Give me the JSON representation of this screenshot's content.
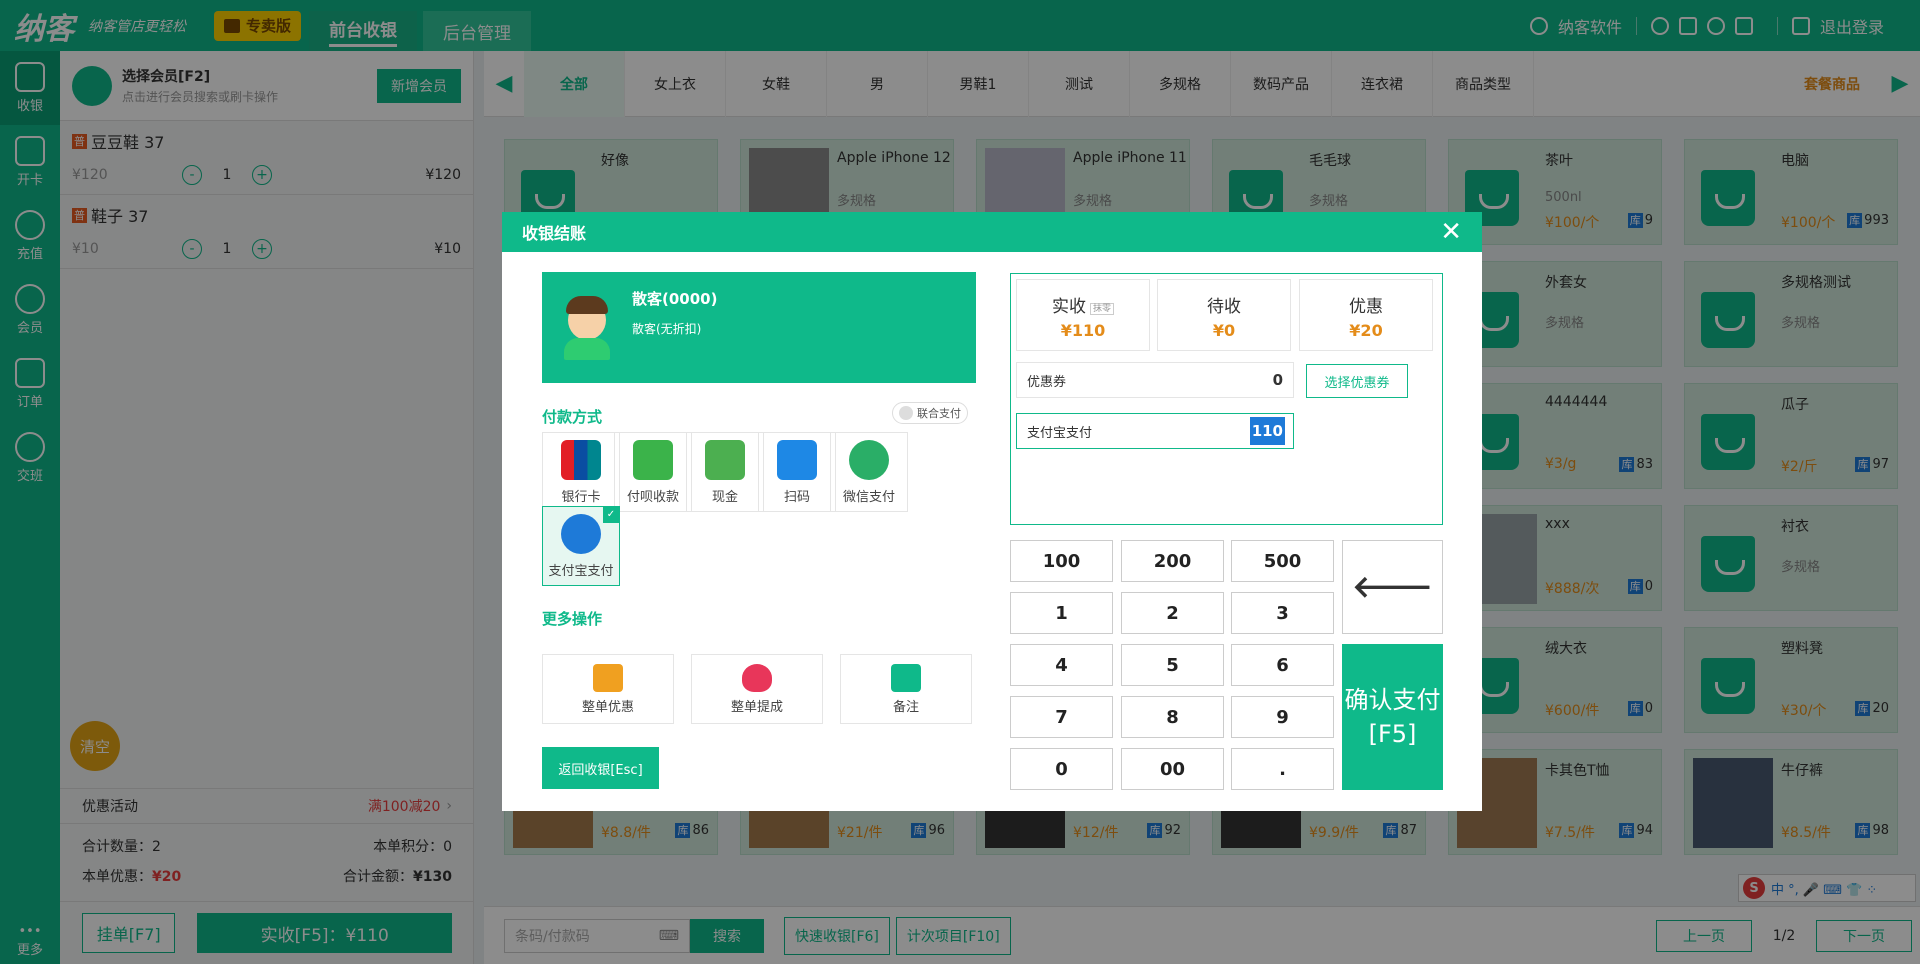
{
  "top": {
    "logo": "纳客",
    "slogan": "纳客管店更轻松",
    "edition": "专卖版",
    "tabs": [
      "前台收银",
      "后台管理"
    ],
    "company": "纳客软件",
    "logout": "退出登录"
  },
  "side": {
    "items": [
      "收银",
      "开卡",
      "充值",
      "会员",
      "订单",
      "交班"
    ],
    "more": "更多"
  },
  "cart": {
    "member_title": "选择会员[F2]",
    "member_hint": "点击进行会员搜索或刷卡操作",
    "add_member": "新增会员",
    "tag": "普",
    "items": [
      {
        "name": "豆豆鞋 37",
        "price": "¥120",
        "qty": "1",
        "sum": "¥120"
      },
      {
        "name": "鞋子 37",
        "price": "¥10",
        "qty": "1",
        "sum": "¥10"
      }
    ],
    "minus": "-",
    "plus": "+",
    "clear": "清空",
    "promo_label": "优惠活动",
    "promo_value": "满100减20",
    "total_qty_label": "合计数量：2",
    "points_label": "本单积分：0",
    "discount_label": "本单优惠：",
    "discount_value": "¥20",
    "total_label": "合计金额：",
    "total_value": "¥130",
    "hang": "挂单[F7]",
    "pay": "实收[F5]：¥110"
  },
  "cats": {
    "items": [
      "全部",
      "女上衣",
      "女鞋",
      "男",
      "男鞋1",
      "测试",
      "多规格",
      "数码产品",
      "连衣裙",
      "商品类型"
    ],
    "special": "套餐商品"
  },
  "products": [
    {
      "name": "好像",
      "spec": "",
      "price": "",
      "stock": ""
    },
    {
      "name": "Apple iPhone 12",
      "spec": "多规格",
      "price": "",
      "stock": ""
    },
    {
      "name": "Apple iPhone 11",
      "spec": "多规格",
      "price": "",
      "stock": ""
    },
    {
      "name": "毛毛球",
      "spec": "多规格",
      "price": "",
      "stock": ""
    },
    {
      "name": "茶叶",
      "spec": "500nl",
      "price": "¥100/个",
      "stock": "9"
    },
    {
      "name": "电脑",
      "spec": "",
      "price": "¥100/个",
      "stock": "993"
    },
    {
      "name": "外套女",
      "spec": "多规格",
      "price": "",
      "stock": ""
    },
    {
      "name": "多规格测试",
      "spec": "多规格",
      "price": "",
      "stock": ""
    },
    {
      "name": "4444444",
      "spec": "",
      "price": "¥3/g",
      "stock": "83"
    },
    {
      "name": "瓜子",
      "spec": "",
      "price": "¥2/斤",
      "stock": "97"
    },
    {
      "name": "xxx",
      "spec": "",
      "price": "¥888/次",
      "stock": "0"
    },
    {
      "name": "衬衣",
      "spec": "多规格",
      "price": "",
      "stock": ""
    },
    {
      "name": "绒大衣",
      "spec": "",
      "price": "¥600/件",
      "stock": "0"
    },
    {
      "name": "塑料凳",
      "spec": "",
      "price": "¥30/个",
      "stock": "20"
    },
    {
      "name": "卡其色T恤",
      "spec": "",
      "price": "¥7.5/件",
      "stock": "94"
    },
    {
      "name": "牛仔裤",
      "spec": "",
      "price": "¥8.5/件",
      "stock": "98"
    },
    {
      "name": "",
      "spec": "",
      "price": "¥8.8/件",
      "stock": "86"
    },
    {
      "name": "",
      "spec": "",
      "price": "¥21/件",
      "stock": "96"
    },
    {
      "name": "",
      "spec": "",
      "price": "¥12/件",
      "stock": "92"
    },
    {
      "name": "",
      "spec": "",
      "price": "¥9.9/件",
      "stock": "87"
    }
  ],
  "stock_tag": "库",
  "bottom": {
    "barcode_placeholder": "条码/付款码",
    "search": "搜索",
    "quick": "快速收银[F6]",
    "timed": "计次项目[F10]",
    "prev": "上一页",
    "page": "1/2",
    "next": "下一页"
  },
  "ime": {
    "logo": "S",
    "text": "中 °, 🎤 ⌨ 👕 ⁘"
  },
  "modal": {
    "title": "收银结账",
    "close": "✕",
    "customer_name": "散客(0000)",
    "customer_discount": "散客(无折扣)",
    "pay_methods_title": "付款方式",
    "combine": "联合支付",
    "pay_methods": [
      "银行卡",
      "付呗收款",
      "现金",
      "扫码",
      "微信支付",
      "支付宝支付"
    ],
    "more_ops_title": "更多操作",
    "ops": [
      "整单优惠",
      "整单提成",
      "备注"
    ],
    "return": "返回收银[Esc]",
    "received_label": "实收",
    "received_mini": "抹零",
    "received_value": "¥110",
    "pending_label": "待收",
    "pending_value": "¥0",
    "discount_label": "优惠",
    "discount_value": "¥20",
    "coupon_label": "优惠券",
    "coupon_value": "0",
    "choose_coupon": "选择优惠券",
    "alipay_label": "支付宝支付",
    "alipay_value": "110",
    "keys": [
      "100",
      "200",
      "500",
      "1",
      "2",
      "3",
      "4",
      "5",
      "6",
      "7",
      "8",
      "9",
      "0",
      "00",
      "."
    ],
    "backspace": "🡐",
    "confirm": "确认支付[F5]"
  },
  "colors": {
    "accent": "#0fb98a",
    "orange": "#e48c1a",
    "red": "#e83d3d",
    "blue": "#1e7ad8"
  }
}
